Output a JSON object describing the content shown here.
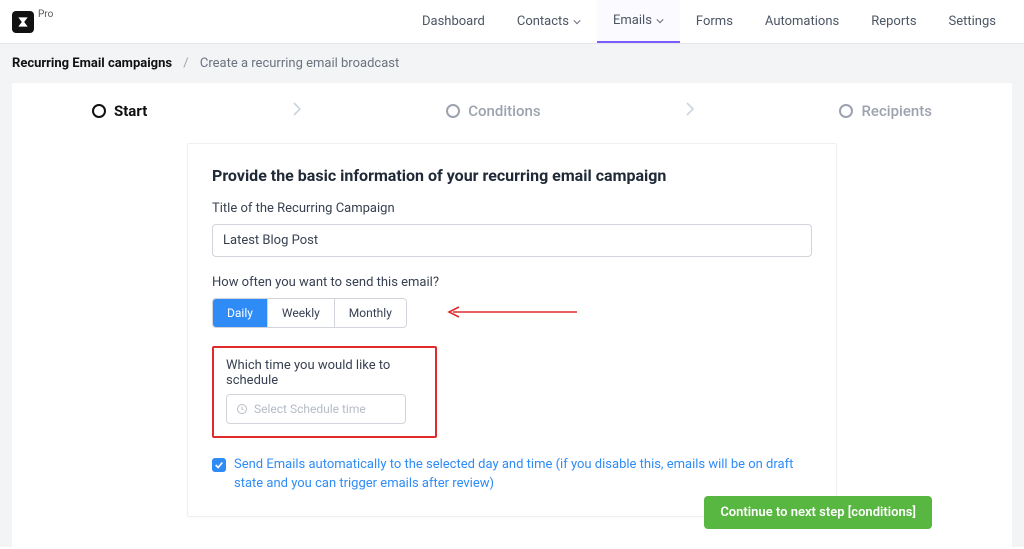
{
  "logo": {
    "pro_label": "Pro"
  },
  "nav": {
    "dashboard": "Dashboard",
    "contacts": "Contacts",
    "emails": "Emails",
    "forms": "Forms",
    "automations": "Automations",
    "reports": "Reports",
    "settings": "Settings"
  },
  "breadcrumb": {
    "root": "Recurring Email campaigns",
    "sep": "/",
    "current": "Create a recurring email broadcast"
  },
  "steps": {
    "start": "Start",
    "conditions": "Conditions",
    "recipients": "Recipients"
  },
  "card": {
    "heading": "Provide the basic information of your recurring email campaign",
    "title_label": "Title of the Recurring Campaign",
    "title_value": "Latest Blog Post",
    "freq_label": "How often you want to send this email?",
    "freq": {
      "daily": "Daily",
      "weekly": "Weekly",
      "monthly": "Monthly"
    },
    "schedule_label": "Which time you would like to schedule",
    "schedule_placeholder": "Select Schedule time",
    "checkbox_text": "Send Emails automatically to the selected day and time (if you disable this, emails will be on draft state and you can trigger emails after review)"
  },
  "footer": {
    "cta": "Continue to next step [conditions]"
  }
}
